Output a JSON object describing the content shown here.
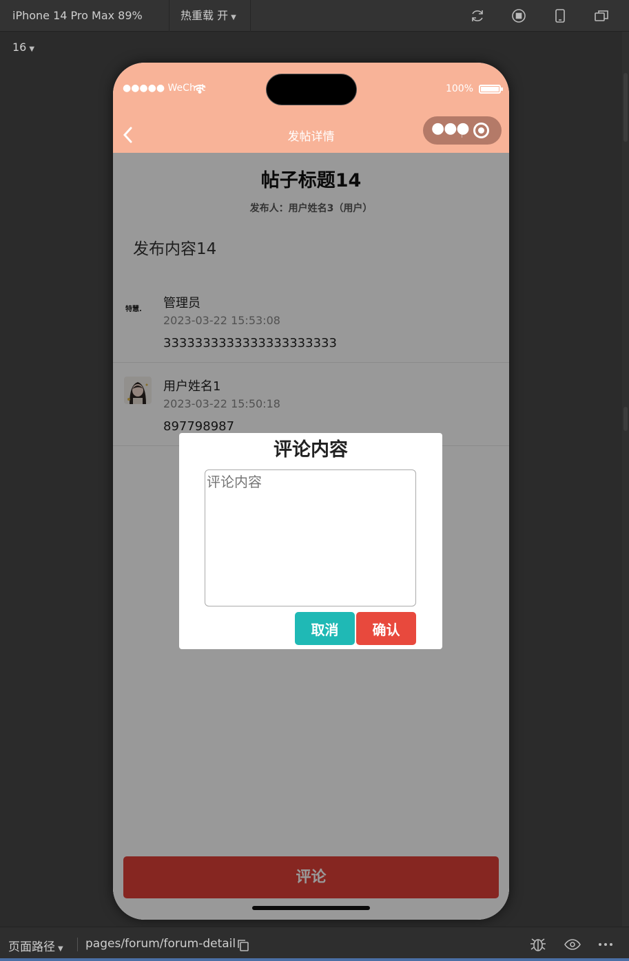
{
  "ide": {
    "device_label": "iPhone 14 Pro Max 89% 16",
    "hot_reload_label": "热重载 开",
    "toolbar_icons": [
      "refresh-icon",
      "stop-icon",
      "phone-icon",
      "window-icon"
    ],
    "page_path_label": "页面路径",
    "page_path_value": "pages/forum/forum-detail",
    "bottom_icons": [
      "copy-icon",
      "debug-icon",
      "preview-icon",
      "more-icon"
    ]
  },
  "status_bar": {
    "carrier": "●●●●● WeChat",
    "battery": "100%"
  },
  "navbar": {
    "title": "发帖详情",
    "color": "#f8b398"
  },
  "post": {
    "title": "帖子标题14",
    "author": "发布人：用户姓名3（用户）",
    "content": "发布内容14"
  },
  "comments": [
    {
      "name": "管理员",
      "time": "2023-03-22 15:53:08",
      "text": "3333333333333333333333",
      "avatar_text": "特慧."
    },
    {
      "name": "用户姓名1",
      "time": "2023-03-22 15:50:18",
      "text": "897798987"
    }
  ],
  "comment_button": {
    "label": "评论",
    "color": "#e04038"
  },
  "dialog": {
    "title": "评论内容",
    "placeholder": "评论内容",
    "value": "",
    "cancel_label": "取消",
    "confirm_label": "确认",
    "cancel_color": "#1fb9b5",
    "confirm_color": "#e8493d"
  }
}
